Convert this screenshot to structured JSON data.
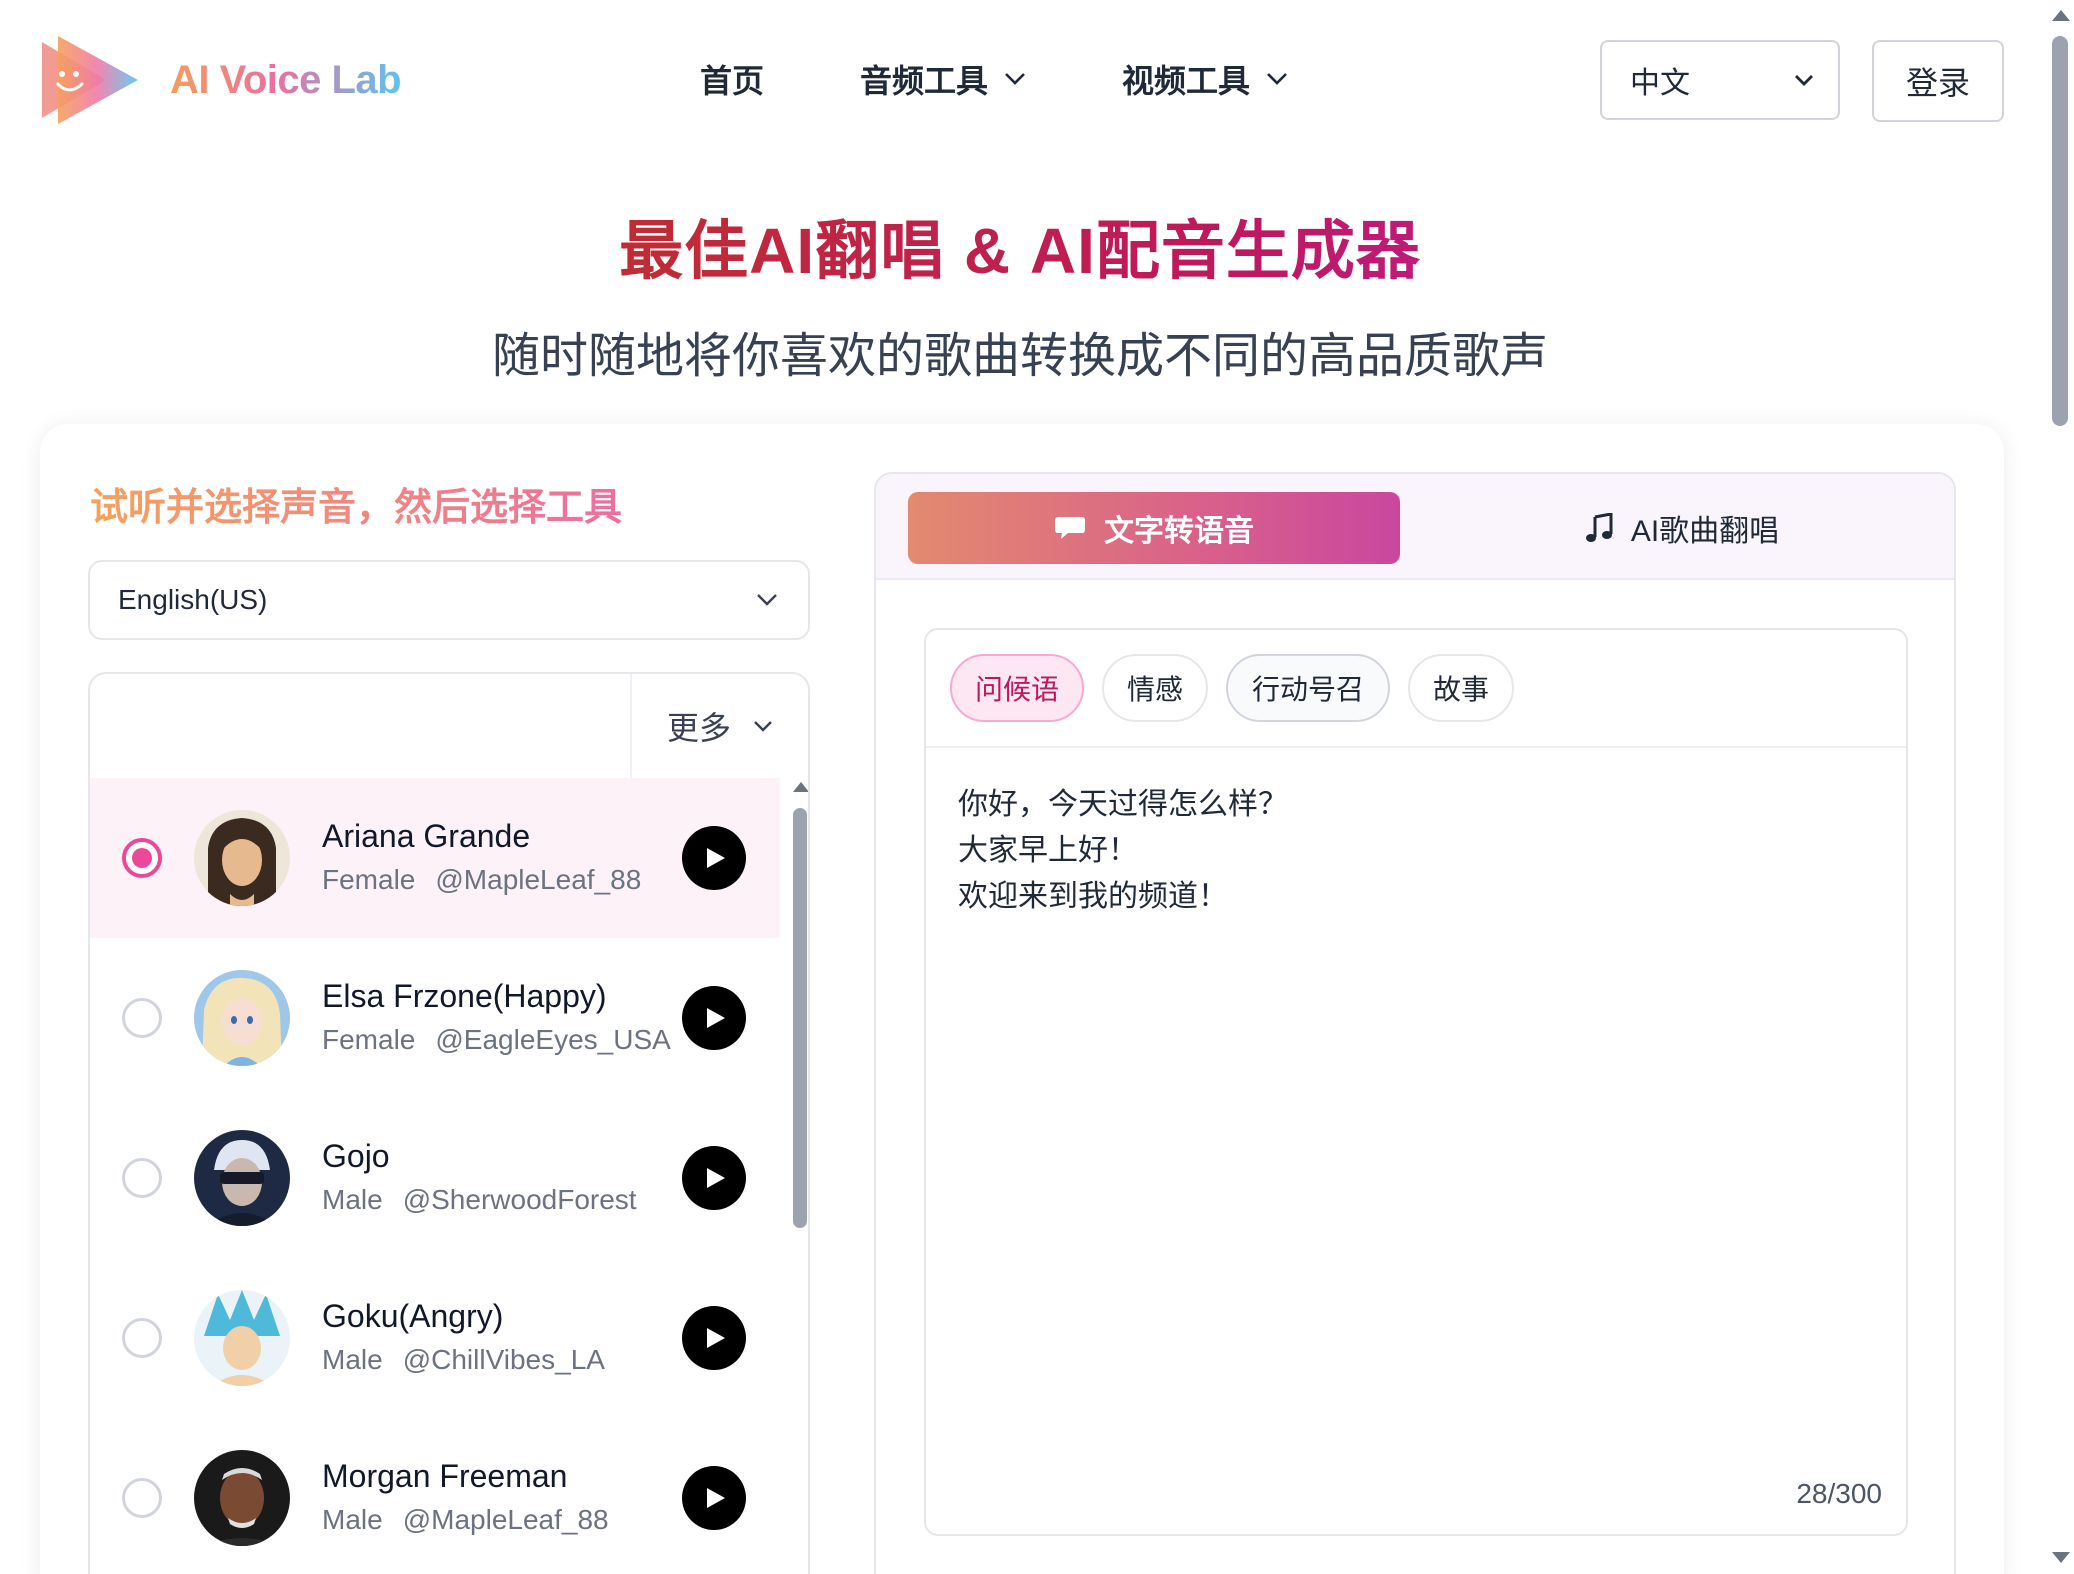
{
  "brand": {
    "name": "AI Voice Lab",
    "logo_icon": "play-smile-logo-icon"
  },
  "nav": {
    "home": "首页",
    "audio_tools": "音频工具",
    "video_tools": "视频工具"
  },
  "language_select": {
    "value": "中文"
  },
  "login": "登录",
  "hero": {
    "title": "最佳AI翻唱 & AI配音生成器",
    "subtitle": "随时随地将你喜欢的歌曲转换成不同的高品质歌声"
  },
  "left": {
    "heading": "试听并选择声音，然后选择工具",
    "voice_language": "English(US)",
    "more_label": "更多",
    "voices": [
      {
        "name": "Ariana Grande",
        "gender": "Female",
        "handle": "@MapleLeaf_88",
        "selected": true
      },
      {
        "name": "Elsa Frzone(Happy)",
        "gender": "Female",
        "handle": "@EagleEyes_USA",
        "selected": false
      },
      {
        "name": "Gojo",
        "gender": "Male",
        "handle": "@SherwoodForest",
        "selected": false
      },
      {
        "name": "Goku(Angry)",
        "gender": "Male",
        "handle": "@ChillVibes_LA",
        "selected": false
      },
      {
        "name": "Morgan Freeman",
        "gender": "Male",
        "handle": "@MapleLeaf_88",
        "selected": false
      }
    ]
  },
  "tools": {
    "tab_tts": "文字转语音",
    "tab_cover": "AI歌曲翻唱",
    "chips": [
      "问候语",
      "情感",
      "行动号召",
      "故事"
    ],
    "active_chip": "问候语",
    "text_lines": [
      "你好，今天过得怎么样？",
      "大家早上好！",
      "欢迎来到我的频道！"
    ],
    "char_count": "28/300"
  },
  "colors": {
    "accent_pink": "#ec4899",
    "accent_orange": "#f5a25d",
    "title_red": "#c2410c"
  }
}
